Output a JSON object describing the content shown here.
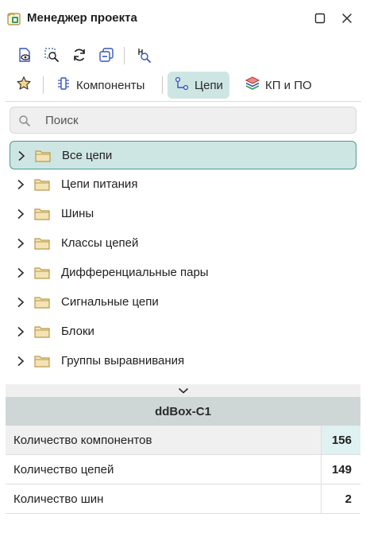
{
  "window": {
    "title": "Менеджер проекта"
  },
  "toolbar": {
    "icons": [
      "document-view-icon",
      "zoom-select-icon",
      "refresh-icon",
      "collapse-all-icon",
      "find-net-icon"
    ]
  },
  "tabs": [
    {
      "label": "",
      "icon": "star-icon"
    },
    {
      "label": "Компоненты",
      "icon": "component-icon"
    },
    {
      "label": "Цепи",
      "icon": "net-icon",
      "active": true
    },
    {
      "label": "КП и ПО",
      "icon": "layers-icon"
    }
  ],
  "search": {
    "placeholder": "Поиск",
    "value": ""
  },
  "tree": {
    "items": [
      {
        "label": "Все цепи",
        "selected": true
      },
      {
        "label": "Цепи питания"
      },
      {
        "label": "Шины"
      },
      {
        "label": "Классы цепей"
      },
      {
        "label": "Дифференциальные пары"
      },
      {
        "label": "Сигнальные цепи"
      },
      {
        "label": "Блоки"
      },
      {
        "label": "Группы выравнивания"
      }
    ]
  },
  "properties": {
    "header": "ddBox-C1",
    "rows": [
      {
        "label": "Количество компонентов",
        "value": "156"
      },
      {
        "label": "Количество цепей",
        "value": "149"
      },
      {
        "label": "Количество шин",
        "value": "2"
      }
    ]
  },
  "colors": {
    "accent": "#cde6e4",
    "accent_border": "#4a9a94",
    "folder_fill": "#f3e3b5",
    "folder_stroke": "#b99a4c",
    "icon_blue": "#3757b8"
  }
}
